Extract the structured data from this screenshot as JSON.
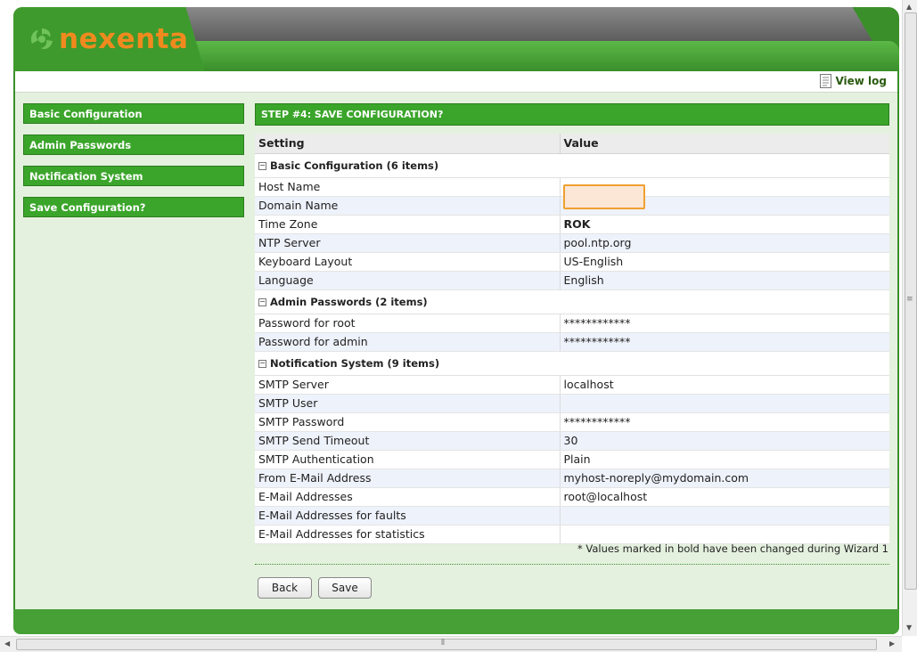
{
  "brand": {
    "name": "nexenta",
    "primary_color": "#3aa52a",
    "logo_color": "#f08a1e"
  },
  "toolbar": {
    "view_log_label": "View log",
    "view_log_icon": "document-icon"
  },
  "sidebar": {
    "items": [
      {
        "label": "Basic Configuration"
      },
      {
        "label": "Admin Passwords"
      },
      {
        "label": "Notification System"
      },
      {
        "label": "Save Configuration?"
      }
    ]
  },
  "main": {
    "step_title": "STEP #4: SAVE CONFIGURATION?",
    "columns": {
      "setting": "Setting",
      "value": "Value"
    },
    "groups": [
      {
        "title": "Basic Configuration (6 items)",
        "rows": [
          {
            "setting": "Host Name",
            "value": ""
          },
          {
            "setting": "Domain Name",
            "value": ""
          },
          {
            "setting": "Time Zone",
            "value": "ROK",
            "bold": true
          },
          {
            "setting": "NTP Server",
            "value": "pool.ntp.org"
          },
          {
            "setting": "Keyboard Layout",
            "value": "US-English"
          },
          {
            "setting": "Language",
            "value": "English"
          }
        ]
      },
      {
        "title": "Admin Passwords (2 items)",
        "rows": [
          {
            "setting": "Password for root",
            "value": "************"
          },
          {
            "setting": "Password for admin",
            "value": "************"
          }
        ]
      },
      {
        "title": "Notification System (9 items)",
        "rows": [
          {
            "setting": "SMTP Server",
            "value": "localhost"
          },
          {
            "setting": "SMTP User",
            "value": ""
          },
          {
            "setting": "SMTP Password",
            "value": "************"
          },
          {
            "setting": "SMTP Send Timeout",
            "value": "30"
          },
          {
            "setting": "SMTP Authentication",
            "value": "Plain"
          },
          {
            "setting": "From E-Mail Address",
            "value": "myhost-noreply@mydomain.com"
          },
          {
            "setting": "E-Mail Addresses",
            "value": "root@localhost"
          },
          {
            "setting": "E-Mail Addresses for faults",
            "value": ""
          },
          {
            "setting": "E-Mail Addresses for statistics",
            "value": ""
          }
        ]
      }
    ],
    "note": "* Values marked in bold have been changed during Wizard 1",
    "buttons": {
      "back": "Back",
      "save": "Save"
    }
  }
}
